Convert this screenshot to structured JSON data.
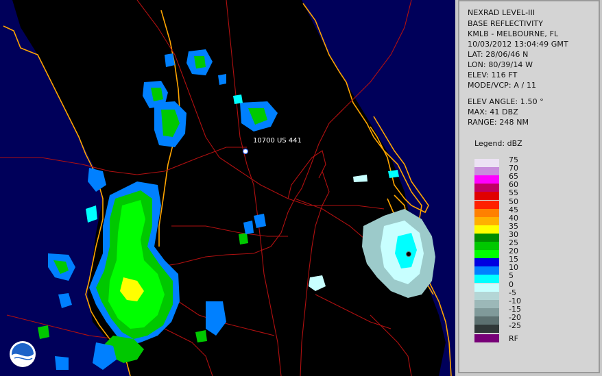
{
  "info": {
    "product": "NEXRAD LEVEL-III",
    "type": "BASE REFLECTIVITY",
    "station": "KMLB - MELBOURNE, FL",
    "datetime": "10/03/2012 13:04:49 GMT",
    "lat": "LAT: 28/06/46 N",
    "lon": "LON: 80/39/14 W",
    "elev": "ELEV: 116 FT",
    "mode": "MODE/VCP: A / 11",
    "elev_angle": "ELEV ANGLE: 1.50 °",
    "max": "MAX: 41 DBZ",
    "range": "RANGE: 248 NM"
  },
  "legend": {
    "title": "Legend: dBZ",
    "levels": [
      {
        "label": "75",
        "color": "#ece2f4"
      },
      {
        "label": "70",
        "color": "#c88ddc"
      },
      {
        "label": "65",
        "color": "#ff00ff"
      },
      {
        "label": "60",
        "color": "#c00064"
      },
      {
        "label": "55",
        "color": "#e00000"
      },
      {
        "label": "50",
        "color": "#ff2000"
      },
      {
        "label": "45",
        "color": "#ff8000"
      },
      {
        "label": "40",
        "color": "#ffb000"
      },
      {
        "label": "35",
        "color": "#ffff00"
      },
      {
        "label": "30",
        "color": "#008c00"
      },
      {
        "label": "25",
        "color": "#00c800"
      },
      {
        "label": "20",
        "color": "#00ff00"
      },
      {
        "label": "15",
        "color": "#0000e0"
      },
      {
        "label": "10",
        "color": "#0080ff"
      },
      {
        "label": "5",
        "color": "#00ffff"
      },
      {
        "label": "0",
        "color": "#c8ffff"
      },
      {
        "label": "-5",
        "color": "#b4d6d6"
      },
      {
        "label": "-10",
        "color": "#9cb8b8"
      },
      {
        "label": "-15",
        "color": "#809a9a"
      },
      {
        "label": "-20",
        "color": "#5c7070"
      },
      {
        "label": "-25",
        "color": "#303838"
      }
    ],
    "rf_label": "RF",
    "rf_color": "#770077"
  },
  "map": {
    "marker_label": "10700 US 441",
    "logo_name": "NOAA",
    "colors": {
      "ocean": "#00005a",
      "land": "#000000",
      "coast": "#ffa500",
      "roads": "#b01010"
    }
  }
}
